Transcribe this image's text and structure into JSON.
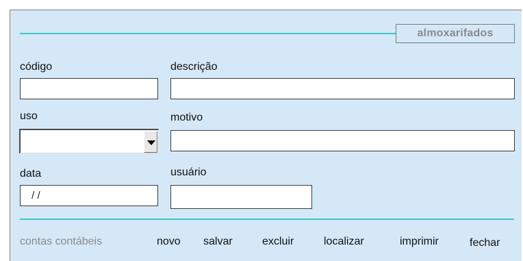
{
  "form": {
    "title": "almoxarifados",
    "codigo": {
      "label": "código",
      "value": ""
    },
    "descricao": {
      "label": "descrição",
      "value": ""
    },
    "uso": {
      "label": "uso",
      "value": "",
      "dropdown_icon": "chevron-down-icon"
    },
    "motivo": {
      "label": "motivo",
      "value": ""
    },
    "data": {
      "label": "data",
      "value": " / /"
    },
    "usuario": {
      "label": "usuário",
      "value": ""
    }
  },
  "toolbar": {
    "contas_contabeis": "contas contábeis",
    "novo": "novo",
    "salvar": "salvar",
    "excluir": "excluir",
    "localizar": "localizar",
    "imprimir": "imprimir",
    "fechar": "fechar"
  },
  "colors": {
    "background": "#d5e8f7",
    "accent_rule": "#3cc6c6",
    "muted_text": "#8b8b8b"
  }
}
